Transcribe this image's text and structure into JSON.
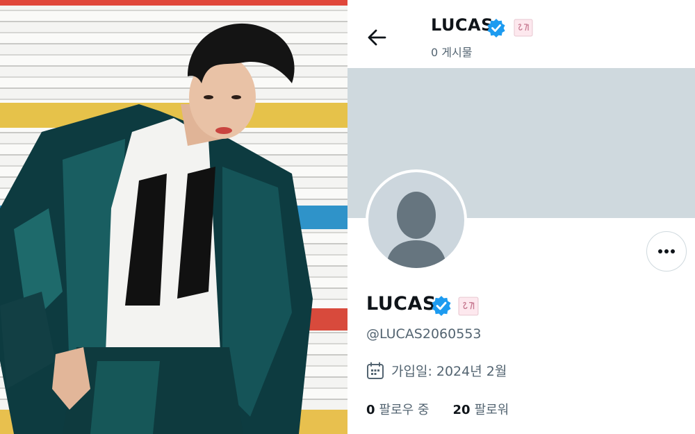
{
  "header": {
    "display_name": "LUCAS",
    "post_count_text": "0 게시물"
  },
  "profile": {
    "display_name": "LUCAS",
    "handle": "@LUCAS2060553",
    "joined_text": "가입일: 2024년 2월",
    "following_count": "0",
    "following_label": "팔로우 중",
    "followers_count": "20",
    "followers_label": "팔로워"
  },
  "icons": {
    "back": "arrow-left-icon",
    "verified": "verified-badge-icon",
    "affiliate": "affiliate-badge-icon",
    "more": "more-horizontal-icon",
    "calendar": "calendar-icon"
  },
  "colors": {
    "verified_blue": "#1d9bf0",
    "banner_gray": "#cfd9de",
    "secondary_text": "#536471",
    "primary_text": "#0f1419"
  }
}
